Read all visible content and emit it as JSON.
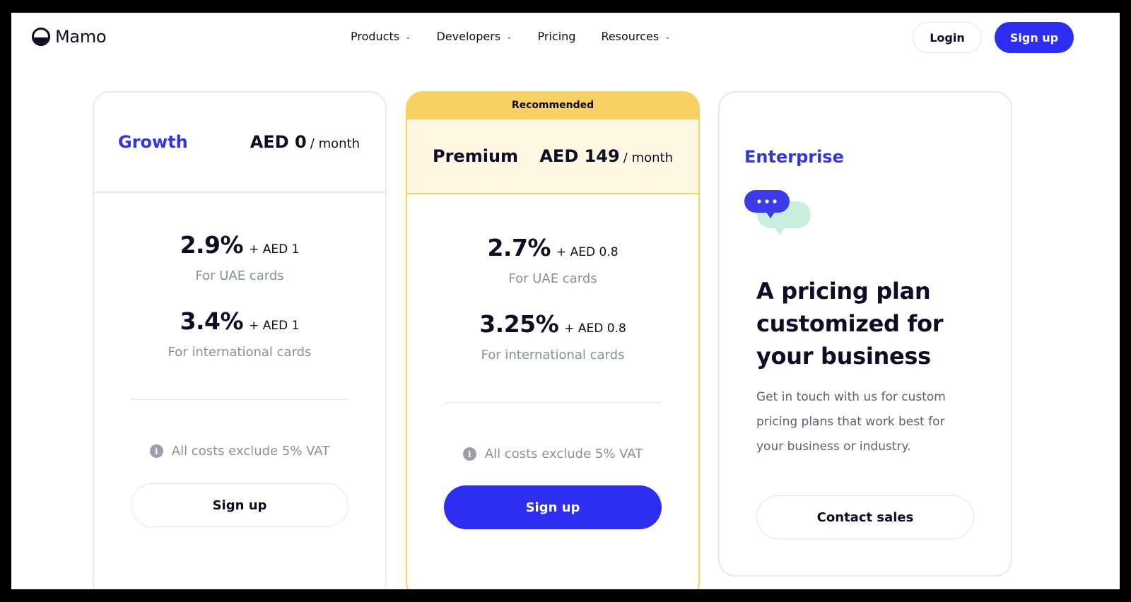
{
  "brand": {
    "name": "Mamo"
  },
  "nav": {
    "links": [
      {
        "label": "Products",
        "dropdown": true
      },
      {
        "label": "Developers",
        "dropdown": true
      },
      {
        "label": "Pricing",
        "dropdown": false
      },
      {
        "label": "Resources",
        "dropdown": true
      }
    ],
    "login_label": "Login",
    "signup_label": "Sign up"
  },
  "colors": {
    "accent": "#2e2ef0",
    "plan_title": "#3434e0",
    "recommended": "#f8d164",
    "premium_bg": "#fff7e1"
  },
  "plans": {
    "growth": {
      "name": "Growth",
      "price": "AED 0",
      "unit": "/ month",
      "uae_rate": "2.9%",
      "uae_fee": "+ AED 1",
      "uae_label": "For UAE cards",
      "intl_rate": "3.4%",
      "intl_fee": "+ AED 1",
      "intl_label": "For international cards",
      "vat_note": "All costs exclude 5% VAT",
      "cta": "Sign up"
    },
    "premium": {
      "badge": "Recommended",
      "name": "Premium",
      "price": "AED 149",
      "unit": "/ month",
      "uae_rate": "2.7%",
      "uae_fee": "+ AED 0.8",
      "uae_label": "For UAE cards",
      "intl_rate": "3.25%",
      "intl_fee": "+ AED 0.8",
      "intl_label": "For international cards",
      "vat_note": "All costs exclude 5% VAT",
      "cta": "Sign up"
    },
    "enterprise": {
      "name": "Enterprise",
      "icon": "chat-bubbles-icon",
      "heading": "A pricing plan customized for your business",
      "description": "Get in touch with us for custom pricing plans that work best for your business or industry.",
      "cta": "Contact sales"
    }
  }
}
